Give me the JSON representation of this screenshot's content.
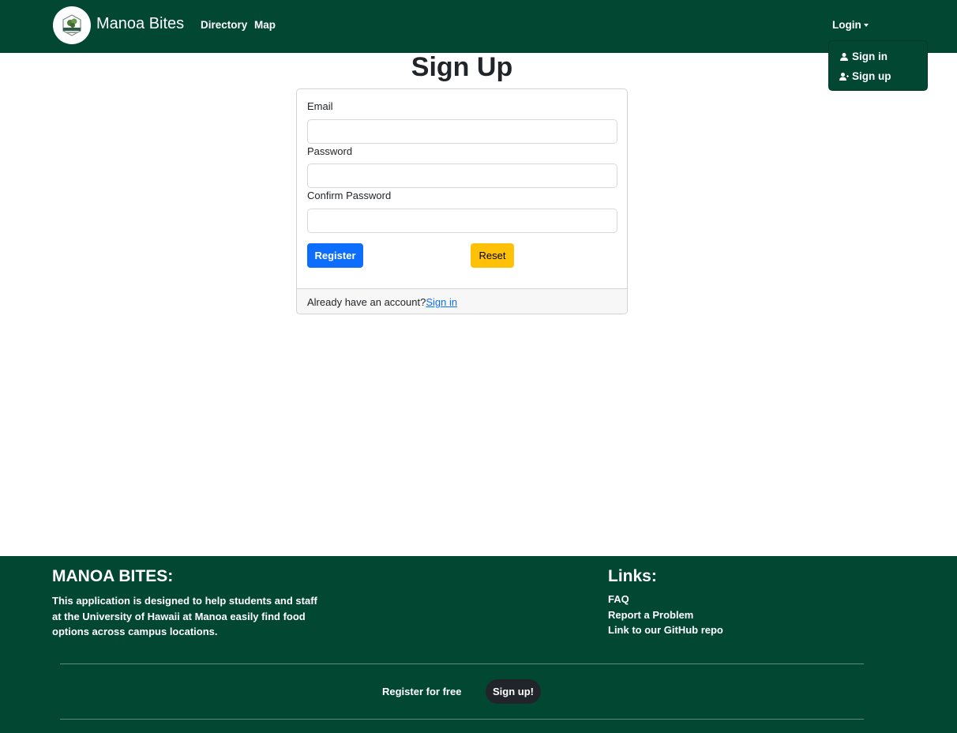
{
  "navbar": {
    "brand": "Manoa Bites",
    "logo_icon": "manoa-bites-logo",
    "links": [
      {
        "label": "Directory"
      },
      {
        "label": "Map"
      }
    ],
    "login_label": "Login",
    "dropdown": {
      "items": [
        {
          "label": "Sign in",
          "icon": "person-icon"
        },
        {
          "label": "Sign up",
          "icon": "person-plus-icon"
        }
      ]
    }
  },
  "page": {
    "title": "Sign Up"
  },
  "form": {
    "email_label": "Email",
    "email_value": "",
    "password_label": "Password",
    "password_value": "",
    "confirm_label": "Confirm Password",
    "confirm_value": "",
    "register_label": "Register",
    "reset_label": "Reset",
    "footer_text": "Already have an account?",
    "footer_link": "Sign in"
  },
  "footer": {
    "title": "MANOA BITES:",
    "description": "This application is designed to help students and staff at the University of Hawaii at Manoa easily find food options across campus locations.",
    "links_title": "Links:",
    "links": [
      {
        "label": "FAQ"
      },
      {
        "label": "Report a Problem"
      },
      {
        "label": "Link to our GitHub repo"
      }
    ],
    "register_text": "Register for free",
    "signup_button": "Sign up!"
  },
  "colors": {
    "brand_green": "#024731",
    "primary": "#0d6efd",
    "warning": "#ffc107",
    "dark": "#212529"
  }
}
